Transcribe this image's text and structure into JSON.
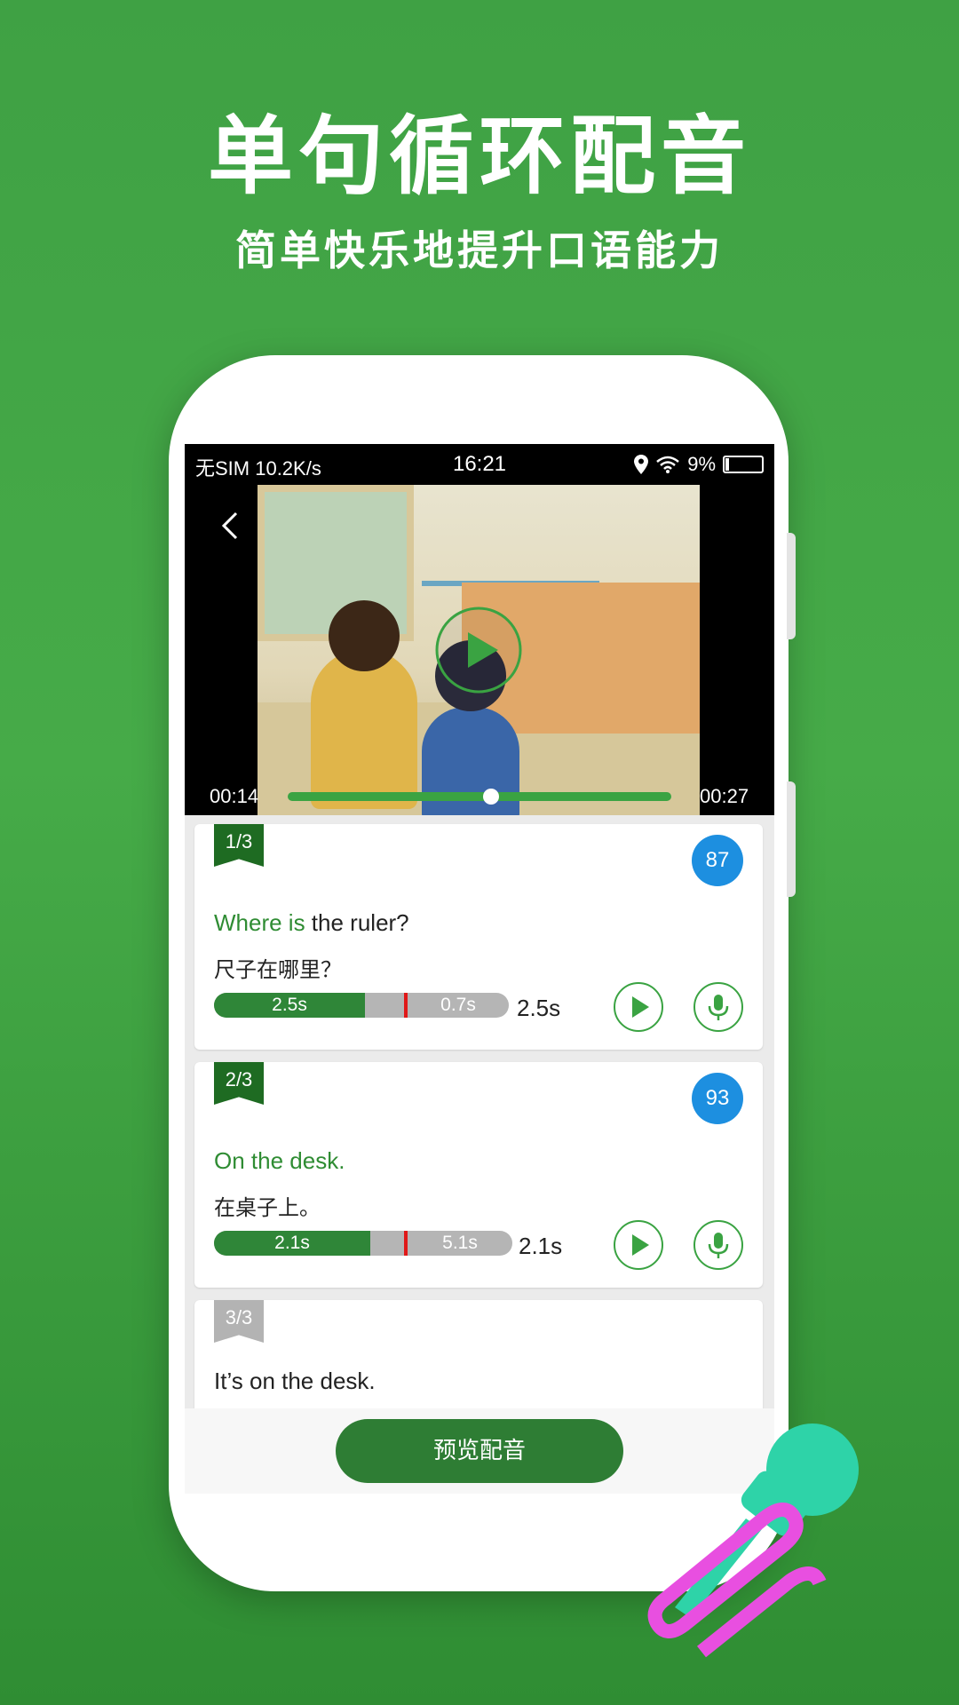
{
  "headline": "单句循环配音",
  "subheadline": "简单快乐地提升口语能力",
  "status_bar": {
    "carrier": "无SIM 10.2K/s",
    "time": "16:21",
    "battery": "9%"
  },
  "video": {
    "current_time": "00:14",
    "total_time": "00:27",
    "progress": 0.52,
    "icons": [
      "back-icon",
      "play-icon"
    ]
  },
  "sentences": [
    {
      "index": "1/3",
      "score": "87",
      "text_highlight": "Where is",
      "text_rest": " the ruler?",
      "translation": "尺子在哪里？",
      "recorded_label": "2.5s",
      "remaining_label": "0.7s",
      "duration": "2.5s",
      "tag_color": "#1e6b22"
    },
    {
      "index": "2/3",
      "score": "93",
      "text_highlight": "On the desk.",
      "text_rest": "",
      "translation": "在桌子上。",
      "recorded_label": "2.1s",
      "remaining_label": "5.1s",
      "duration": "2.1s",
      "tag_color": "#1e6b22"
    },
    {
      "index": "3/3",
      "text_highlight": "",
      "text_rest": "It’s on the desk.",
      "tag_color": "#b3b3b3"
    }
  ],
  "footer": {
    "preview_button": "预览配音"
  },
  "colors": {
    "accent_green": "#3aa342",
    "dark_green": "#2e7d34",
    "score_blue": "#1d8fe0",
    "marker_red": "#e01818",
    "mic_teal": "#2ed3a8",
    "mic_pink": "#e84fe0"
  }
}
